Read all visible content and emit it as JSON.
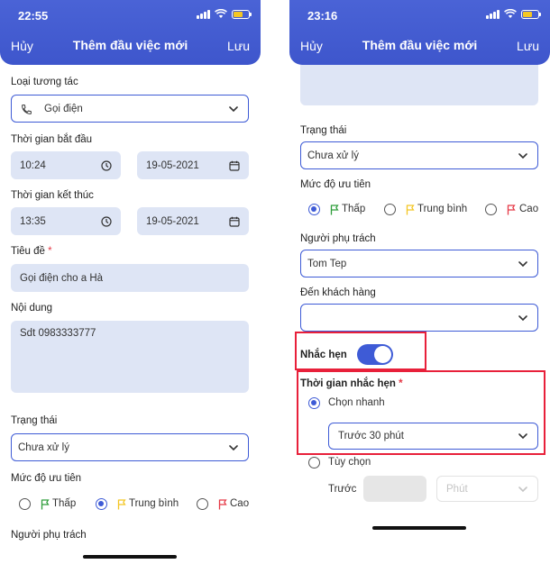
{
  "left": {
    "status_time": "22:55",
    "header": {
      "cancel": "Hủy",
      "title": "Thêm đầu việc mới",
      "save": "Lưu"
    },
    "interaction_type": {
      "label": "Loại tương tác",
      "value": "Gọi điện",
      "icon": "phone-icon"
    },
    "start_time": {
      "label": "Thời gian bắt đầu",
      "time": "10:24",
      "date": "19-05-2021"
    },
    "end_time": {
      "label": "Thời gian kết thúc",
      "time": "13:35",
      "date": "19-05-2021"
    },
    "title_field": {
      "label": "Tiêu đề",
      "required": "*",
      "value": "Gọi điện cho a Hà"
    },
    "content": {
      "label": "Nội dung",
      "value": "Sdt 0983333777"
    },
    "status": {
      "label": "Trạng thái",
      "value": "Chưa xử lý"
    },
    "priority": {
      "label": "Mức độ ưu tiên",
      "options": [
        {
          "label": "Thấp",
          "selected": false,
          "flag_color": "#2e9d3a"
        },
        {
          "label": "Trung bình",
          "selected": true,
          "flag_color": "#f3c623"
        },
        {
          "label": "Cao",
          "selected": false,
          "flag_color": "#e53946"
        }
      ]
    },
    "assignee": {
      "label": "Người phụ trách"
    }
  },
  "right": {
    "status_time": "23:16",
    "header": {
      "cancel": "Hủy",
      "title": "Thêm đầu việc mới",
      "save": "Lưu"
    },
    "status": {
      "label": "Trạng thái",
      "value": "Chưa xử lý"
    },
    "priority": {
      "label": "Mức độ ưu tiên",
      "options": [
        {
          "label": "Thấp",
          "selected": true,
          "flag_color": "#2e9d3a"
        },
        {
          "label": "Trung bình",
          "selected": false,
          "flag_color": "#f3c623"
        },
        {
          "label": "Cao",
          "selected": false,
          "flag_color": "#e53946"
        }
      ]
    },
    "assignee": {
      "label": "Người phụ trách",
      "value": "Tom Tep"
    },
    "customer": {
      "label": "Đến khách hàng",
      "value": ""
    },
    "reminder": {
      "label": "Nhắc hẹn",
      "enabled": true
    },
    "reminder_time": {
      "label": "Thời gian nhắc hẹn",
      "required": "*",
      "quick": {
        "label": "Chọn nhanh",
        "selected": true,
        "value": "Trước 30 phút"
      },
      "custom": {
        "label": "Tùy chọn",
        "selected": false,
        "before_label": "Trước",
        "number_value": "",
        "unit_placeholder": "Phút"
      }
    }
  },
  "colors": {
    "accent": "#3e5bd6",
    "field_fill": "#dee5f5",
    "highlight": "#e8203a"
  }
}
